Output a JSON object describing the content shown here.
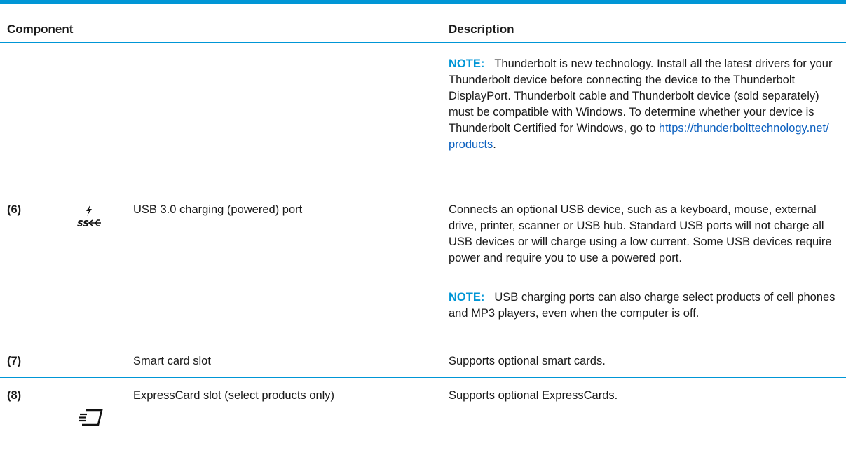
{
  "header": {
    "component": "Component",
    "description": "Description"
  },
  "note_label": "NOTE:",
  "rows": [
    {
      "note_before_link": "Thunderbolt is new technology. Install all the latest drivers for your Thunderbolt device before connecting the device to the Thunderbolt DisplayPort. Thunderbolt cable and Thunderbolt device (sold separately) must be compatible with Windows. To determine whether your device is Thunderbolt Certified for Windows, go to ",
      "link_line1": "https://thunderbolttechnology.net/",
      "link_line2": "products",
      "note_after_link": "."
    },
    {
      "number": "(6)",
      "icon": "usb-superspeed-charging-icon",
      "component": "USB 3.0 charging (powered) port",
      "description": "Connects an optional USB device, such as a keyboard, mouse, external drive, printer, scanner or USB hub. Standard USB ports will not charge all USB devices or will charge using a low current. Some USB devices require power and require you to use a powered port.",
      "note": "USB charging ports can also charge select products of cell phones and MP3 players, even when the computer is off."
    },
    {
      "number": "(7)",
      "component": "Smart card slot",
      "description": "Supports optional smart cards."
    },
    {
      "number": "(8)",
      "icon": "expresscard-icon",
      "component": "ExpressCard slot (select products only)",
      "description": "Supports optional ExpressCards."
    }
  ],
  "colors": {
    "accent": "#0096d6",
    "link": "#0a5fbf"
  }
}
